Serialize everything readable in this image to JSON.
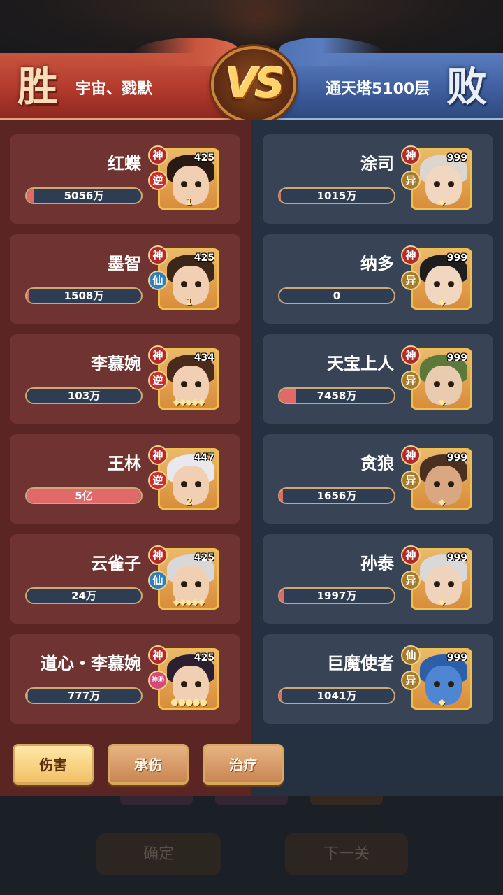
{
  "header": {
    "win_label": "胜",
    "lose_label": "败",
    "vs_label": "VS",
    "left_team": "宇宙、戮默",
    "right_team": "通天塔5100层"
  },
  "colors": {
    "win_red": "#b23a2d",
    "lose_blue": "#3f5f9f",
    "damage_bar": "#e06a6a",
    "portrait_border": "#f0c04a"
  },
  "left_heroes": [
    {
      "name": "红蝶",
      "value": "5056万",
      "level": "425",
      "badge1": "神",
      "badge2": "逆",
      "stars": "1",
      "fill": 0.06
    },
    {
      "name": "墨智",
      "value": "1508万",
      "level": "425",
      "badge1": "神",
      "badge2": "仙",
      "stars": "1",
      "fill": 0.02
    },
    {
      "name": "李慕婉",
      "value": "103万",
      "level": "434",
      "badge1": "神",
      "badge2": "逆",
      "stars": "◆◆◆◆◆",
      "fill": 0.0
    },
    {
      "name": "王林",
      "value": "5亿",
      "level": "447",
      "badge1": "神",
      "badge2": "逆",
      "stars": "2",
      "fill": 1.0
    },
    {
      "name": "云雀子",
      "value": "24万",
      "level": "425",
      "badge1": "神",
      "badge2": "仙",
      "stars": "◆◆◆◆◆",
      "fill": 0.0
    },
    {
      "name": "道心・李慕婉",
      "value": "777万",
      "level": "425",
      "badge1": "神",
      "badge2": "神助",
      "stars": "●●●●●",
      "fill": 0.01
    }
  ],
  "right_heroes": [
    {
      "name": "涂司",
      "value": "1015万",
      "level": "999",
      "badge1": "神",
      "badge2": "异",
      "stars": "◆",
      "fill": 0.01
    },
    {
      "name": "纳多",
      "value": "0",
      "level": "999",
      "badge1": "神",
      "badge2": "异",
      "stars": "◆",
      "fill": 0.0
    },
    {
      "name": "天宝上人",
      "value": "7458万",
      "level": "999",
      "badge1": "神",
      "badge2": "异",
      "stars": "◆",
      "fill": 0.14
    },
    {
      "name": "贪狼",
      "value": "1656万",
      "level": "999",
      "badge1": "神",
      "badge2": "异",
      "stars": "◆",
      "fill": 0.03
    },
    {
      "name": "孙泰",
      "value": "1997万",
      "level": "999",
      "badge1": "神",
      "badge2": "异",
      "stars": "◆",
      "fill": 0.04
    },
    {
      "name": "巨魔使者",
      "value": "1041万",
      "level": "999",
      "badge1": "仙",
      "badge2": "异",
      "stars": "◆",
      "fill": 0.02
    }
  ],
  "tabs": [
    {
      "label": "伤害",
      "active": true
    },
    {
      "label": "承伤",
      "active": false
    },
    {
      "label": "治疗",
      "active": false
    }
  ],
  "footer": {
    "confirm_label": "确定",
    "next_label": "下一关"
  }
}
